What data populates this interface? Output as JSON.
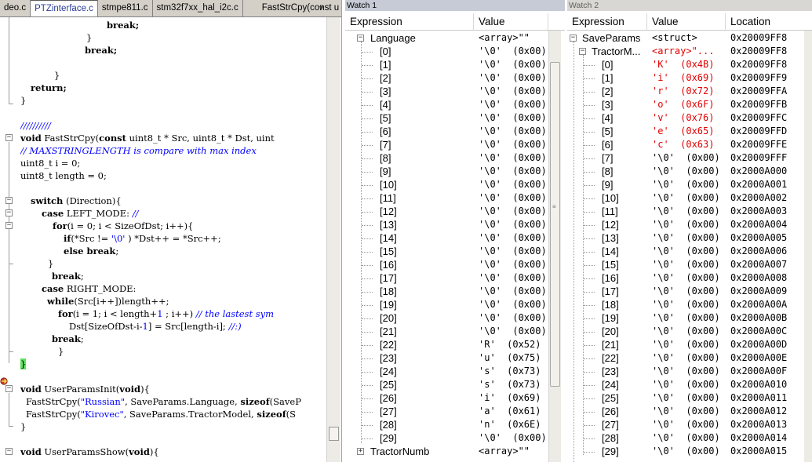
{
  "tabs": [
    {
      "label": "deo.c",
      "active": false
    },
    {
      "label": "PTZinterface.c",
      "active": true
    },
    {
      "label": "stmpe811.c",
      "active": false
    },
    {
      "label": "stm32f7xx_hal_i2c.c",
      "active": false
    }
  ],
  "function_dropdown": "FastStrCpy(const u",
  "code": {
    "l1": "break;",
    "l2": "}",
    "l3": "break;",
    "l4": "}",
    "l5": "return;",
    "l6": "}",
    "l7": "//////////",
    "l8a": "void",
    "l8b": " FastStrCpy(",
    "l8c": "const",
    "l8d": " uint8_t * Src, uint8_t * Dst, uint",
    "l9": "// MAXSTRINGLENGTH is compare with max index",
    "l10": "uint8_t i = 0;",
    "l11": "uint8_t length = 0;",
    "l12a": "switch",
    "l12b": " (Direction){",
    "l13a": "case",
    "l13b": " LEFT_MODE: ",
    "l13c": "//",
    "l14a": "for",
    "l14b": "(i = 0; i < SizeOfDst; i++){",
    "l15a": "if",
    "l15b": "(*Src != ",
    "l15c": "'\\0'",
    "l15d": " ) *Dst++ = *Src++;",
    "l16a": "else break",
    "l16b": ";",
    "l17": "}",
    "l18a": "break",
    "l18b": ";",
    "l19a": "case",
    "l19b": " RIGHT_MODE:",
    "l20a": "while",
    "l20b": "(Src[i++])length++;",
    "l21a": "for",
    "l21b": "(i = 1; i < length+",
    "l21c": "1",
    "l21d": " ; i++) ",
    "l21e": "// the lastest sym",
    "l22a": "Dst[SizeOfDst-i-",
    "l22b": "1",
    "l22c": "] = Src[length-i]; ",
    "l22d": "//:)",
    "l23a": "break",
    "l23b": ";",
    "l24": "}",
    "l25": "}",
    "l26a": "void",
    "l26b": " UserParamsInit(",
    "l26c": "void",
    "l26d": "){",
    "l27a": "FastStrCpy(",
    "l27b": "\"Russian\"",
    "l27c": ", SaveParams.Language, ",
    "l27d": "sizeof",
    "l27e": "(SaveP",
    "l28a": "FastStrCpy(",
    "l28b": "\"Kirovec\"",
    "l28c": ", SaveParams.TractorModel, ",
    "l28d": "sizeof",
    "l28e": "(S",
    "l29": "}",
    "l30a": "void",
    "l30b": " UserParamsShow(",
    "l30c": "void",
    "l30d": "){"
  },
  "watch1": {
    "title": "Watch 1",
    "col_expression": "Expression",
    "col_value": "Value",
    "root_name": "Language",
    "root_value": "<array>\"\"",
    "items": [
      {
        "idx": "[0]",
        "val": "'\\0'  (0x00)"
      },
      {
        "idx": "[1]",
        "val": "'\\0'  (0x00)"
      },
      {
        "idx": "[2]",
        "val": "'\\0'  (0x00)"
      },
      {
        "idx": "[3]",
        "val": "'\\0'  (0x00)"
      },
      {
        "idx": "[4]",
        "val": "'\\0'  (0x00)"
      },
      {
        "idx": "[5]",
        "val": "'\\0'  (0x00)"
      },
      {
        "idx": "[6]",
        "val": "'\\0'  (0x00)"
      },
      {
        "idx": "[7]",
        "val": "'\\0'  (0x00)"
      },
      {
        "idx": "[8]",
        "val": "'\\0'  (0x00)"
      },
      {
        "idx": "[9]",
        "val": "'\\0'  (0x00)"
      },
      {
        "idx": "[10]",
        "val": "'\\0'  (0x00)"
      },
      {
        "idx": "[11]",
        "val": "'\\0'  (0x00)"
      },
      {
        "idx": "[12]",
        "val": "'\\0'  (0x00)"
      },
      {
        "idx": "[13]",
        "val": "'\\0'  (0x00)"
      },
      {
        "idx": "[14]",
        "val": "'\\0'  (0x00)"
      },
      {
        "idx": "[15]",
        "val": "'\\0'  (0x00)"
      },
      {
        "idx": "[16]",
        "val": "'\\0'  (0x00)"
      },
      {
        "idx": "[17]",
        "val": "'\\0'  (0x00)"
      },
      {
        "idx": "[18]",
        "val": "'\\0'  (0x00)"
      },
      {
        "idx": "[19]",
        "val": "'\\0'  (0x00)"
      },
      {
        "idx": "[20]",
        "val": "'\\0'  (0x00)"
      },
      {
        "idx": "[21]",
        "val": "'\\0'  (0x00)"
      },
      {
        "idx": "[22]",
        "val": "'R'  (0x52)"
      },
      {
        "idx": "[23]",
        "val": "'u'  (0x75)"
      },
      {
        "idx": "[24]",
        "val": "'s'  (0x73)"
      },
      {
        "idx": "[25]",
        "val": "'s'  (0x73)"
      },
      {
        "idx": "[26]",
        "val": "'i'  (0x69)"
      },
      {
        "idx": "[27]",
        "val": "'a'  (0x61)"
      },
      {
        "idx": "[28]",
        "val": "'n'  (0x6E)"
      },
      {
        "idx": "[29]",
        "val": "'\\0'  (0x00)"
      }
    ],
    "next_name": "TractorNumb",
    "next_value": "<array>\"\""
  },
  "watch2": {
    "title": "Watch 2",
    "col_expression": "Expression",
    "col_value": "Value",
    "col_location": "Location",
    "root_name": "SaveParams",
    "root_value": "<struct>",
    "root_location": "0x20009FF8",
    "child_name": "TractorM...",
    "child_value": "<array>\"...",
    "child_location": "0x20009FF8",
    "items": [
      {
        "idx": "[0]",
        "val": "'K'  (0x4B)",
        "loc": "0x20009FF8",
        "changed": true
      },
      {
        "idx": "[1]",
        "val": "'i'  (0x69)",
        "loc": "0x20009FF9",
        "changed": true
      },
      {
        "idx": "[2]",
        "val": "'r'  (0x72)",
        "loc": "0x20009FFA",
        "changed": true
      },
      {
        "idx": "[3]",
        "val": "'o'  (0x6F)",
        "loc": "0x20009FFB",
        "changed": true
      },
      {
        "idx": "[4]",
        "val": "'v'  (0x76)",
        "loc": "0x20009FFC",
        "changed": true
      },
      {
        "idx": "[5]",
        "val": "'e'  (0x65)",
        "loc": "0x20009FFD",
        "changed": true
      },
      {
        "idx": "[6]",
        "val": "'c'  (0x63)",
        "loc": "0x20009FFE",
        "changed": true
      },
      {
        "idx": "[7]",
        "val": "'\\0'  (0x00)",
        "loc": "0x20009FFF",
        "changed": false
      },
      {
        "idx": "[8]",
        "val": "'\\0'  (0x00)",
        "loc": "0x2000A000",
        "changed": false
      },
      {
        "idx": "[9]",
        "val": "'\\0'  (0x00)",
        "loc": "0x2000A001",
        "changed": false
      },
      {
        "idx": "[10]",
        "val": "'\\0'  (0x00)",
        "loc": "0x2000A002",
        "changed": false
      },
      {
        "idx": "[11]",
        "val": "'\\0'  (0x00)",
        "loc": "0x2000A003",
        "changed": false
      },
      {
        "idx": "[12]",
        "val": "'\\0'  (0x00)",
        "loc": "0x2000A004",
        "changed": false
      },
      {
        "idx": "[13]",
        "val": "'\\0'  (0x00)",
        "loc": "0x2000A005",
        "changed": false
      },
      {
        "idx": "[14]",
        "val": "'\\0'  (0x00)",
        "loc": "0x2000A006",
        "changed": false
      },
      {
        "idx": "[15]",
        "val": "'\\0'  (0x00)",
        "loc": "0x2000A007",
        "changed": false
      },
      {
        "idx": "[16]",
        "val": "'\\0'  (0x00)",
        "loc": "0x2000A008",
        "changed": false
      },
      {
        "idx": "[17]",
        "val": "'\\0'  (0x00)",
        "loc": "0x2000A009",
        "changed": false
      },
      {
        "idx": "[18]",
        "val": "'\\0'  (0x00)",
        "loc": "0x2000A00A",
        "changed": false
      },
      {
        "idx": "[19]",
        "val": "'\\0'  (0x00)",
        "loc": "0x2000A00B",
        "changed": false
      },
      {
        "idx": "[20]",
        "val": "'\\0'  (0x00)",
        "loc": "0x2000A00C",
        "changed": false
      },
      {
        "idx": "[21]",
        "val": "'\\0'  (0x00)",
        "loc": "0x2000A00D",
        "changed": false
      },
      {
        "idx": "[22]",
        "val": "'\\0'  (0x00)",
        "loc": "0x2000A00E",
        "changed": false
      },
      {
        "idx": "[23]",
        "val": "'\\0'  (0x00)",
        "loc": "0x2000A00F",
        "changed": false
      },
      {
        "idx": "[24]",
        "val": "'\\0'  (0x00)",
        "loc": "0x2000A010",
        "changed": false
      },
      {
        "idx": "[25]",
        "val": "'\\0'  (0x00)",
        "loc": "0x2000A011",
        "changed": false
      },
      {
        "idx": "[26]",
        "val": "'\\0'  (0x00)",
        "loc": "0x2000A012",
        "changed": false
      },
      {
        "idx": "[27]",
        "val": "'\\0'  (0x00)",
        "loc": "0x2000A013",
        "changed": false
      },
      {
        "idx": "[28]",
        "val": "'\\0'  (0x00)",
        "loc": "0x2000A014",
        "changed": false
      },
      {
        "idx": "[29]",
        "val": "'\\0'  (0x00)",
        "loc": "0x2000A015",
        "changed": false
      }
    ]
  },
  "icons": {
    "breakpoint": "breakpoint-arrow-icon",
    "expand": "expand-icon",
    "collapse": "collapse-icon"
  },
  "colors": {
    "changed_value": "#e00000",
    "string_literal": "#0000ff",
    "comment": "#0000ff",
    "current_line_brace": "#5fe05f",
    "active_tab_text": "#2a3c9a"
  }
}
